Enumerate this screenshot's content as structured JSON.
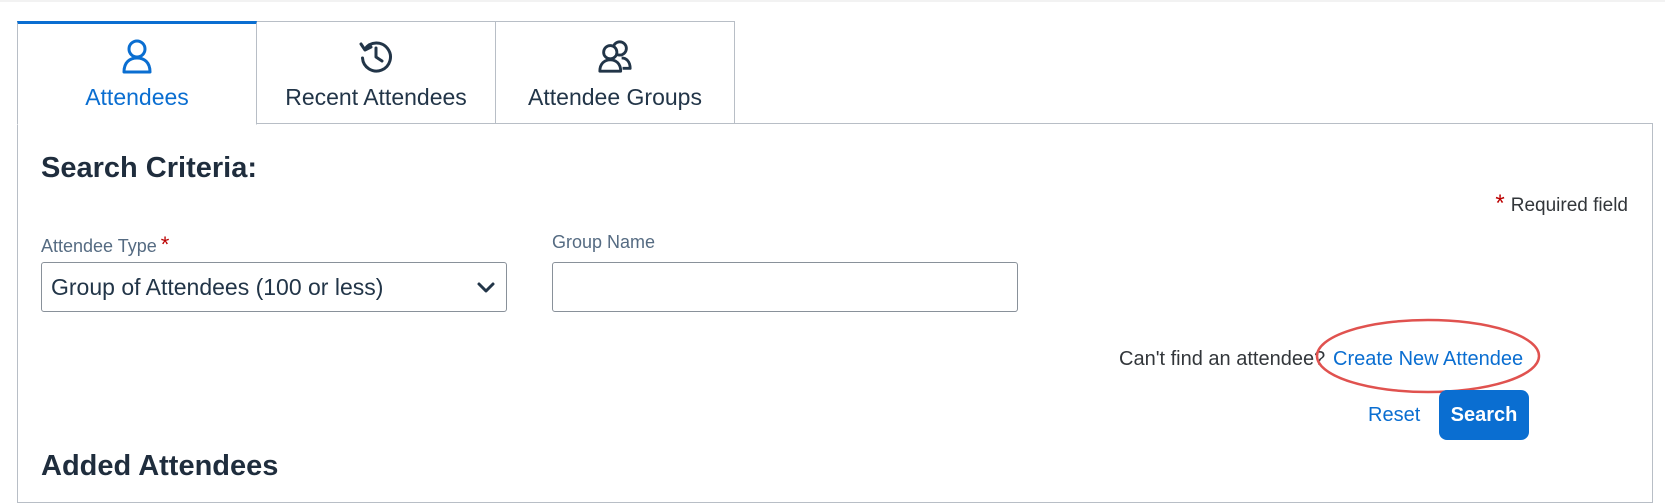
{
  "tabs": [
    {
      "label": "Attendees",
      "icon": "person-icon",
      "active": true
    },
    {
      "label": "Recent Attendees",
      "icon": "history-icon",
      "active": false
    },
    {
      "label": "Attendee Groups",
      "icon": "group-icon",
      "active": false
    }
  ],
  "search": {
    "title": "Search Criteria:",
    "required_note": "Required field",
    "required_star": "*",
    "attendee_type_label": "Attendee Type",
    "attendee_type_value": "Group of Attendees (100 or less)",
    "group_name_label": "Group Name",
    "group_name_value": ""
  },
  "actions": {
    "cant_find_text": "Can't find an attendee?",
    "create_link": "Create New Attendee",
    "reset_label": "Reset",
    "search_label": "Search"
  },
  "next_section": {
    "title": "Added Attendees"
  },
  "colors": {
    "accent": "#0a6ed1",
    "required": "#bb0000",
    "annotation": "#e0524f"
  }
}
